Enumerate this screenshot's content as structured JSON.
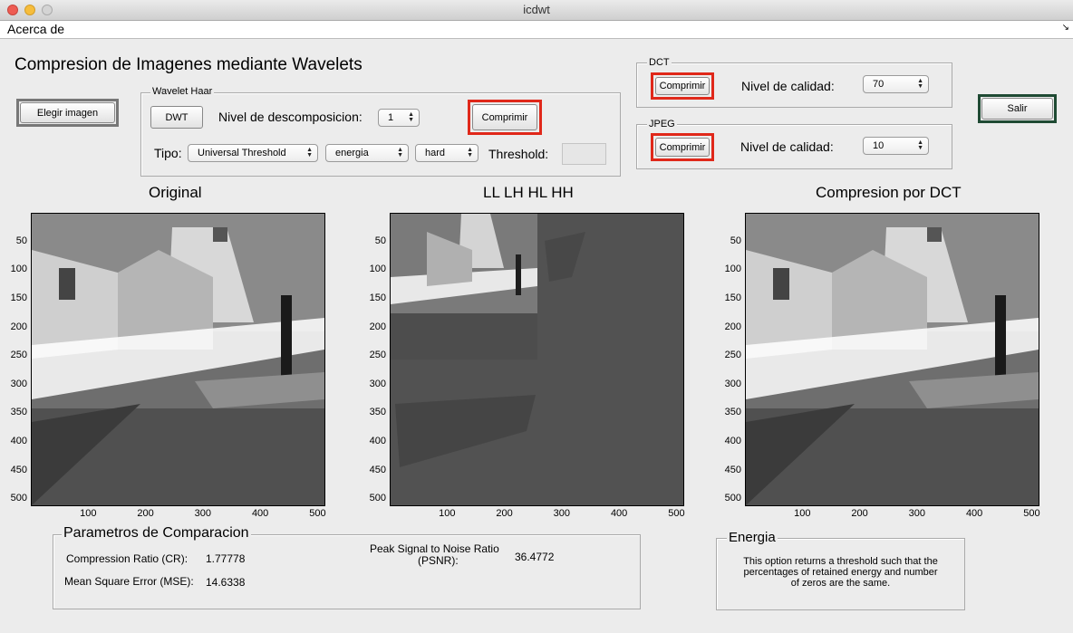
{
  "window": {
    "title": "icdwt"
  },
  "menu": {
    "acerca": "Acerca de"
  },
  "header": {
    "title": "Compresion de Imagenes mediante Wavelets"
  },
  "buttons": {
    "elegir": "Elegir imagen",
    "dwt": "DWT",
    "comprimir": "Comprimir",
    "salir": "Salir"
  },
  "wavelet": {
    "panel_title": "Wavelet Haar",
    "nivel_label": "Nivel de descomposicion:",
    "nivel_value": "1",
    "tipo_label": "Tipo:",
    "tipo_value": "Universal Threshold",
    "energia_value": "energia",
    "mode_value": "hard",
    "threshold_label": "Threshold:",
    "threshold_value": ""
  },
  "dct": {
    "panel_title": "DCT",
    "calidad_label": "Nivel de calidad:",
    "calidad_value": "70"
  },
  "jpeg": {
    "panel_title": "JPEG",
    "calidad_label": "Nivel de calidad:",
    "calidad_value": "10"
  },
  "axes": {
    "original_title": "Original",
    "dwt_title": "LL LH HL HH",
    "dct_title": "Compresion por DCT",
    "yticks": [
      "50",
      "100",
      "150",
      "200",
      "250",
      "300",
      "350",
      "400",
      "450",
      "500"
    ],
    "xticks": [
      "100",
      "200",
      "300",
      "400",
      "500"
    ]
  },
  "params": {
    "panel_title": "Parametros de Comparacion",
    "cr_label": "Compression Ratio (CR):",
    "cr_value": "1.77778",
    "mse_label": "Mean Square Error (MSE):",
    "mse_value": "14.6338",
    "psnr_label_1": "Peak Signal to Noise Ratio",
    "psnr_label_2": "(PSNR):",
    "psnr_value": "36.4772"
  },
  "energia": {
    "panel_title": "Energia",
    "text_1": "This option returns a threshold such that the",
    "text_2": "percentages of retained energy and number",
    "text_3": "of zeros are the same."
  },
  "colors": {
    "red_accent": "#e0281a",
    "salir_border": "#1f4a33"
  }
}
